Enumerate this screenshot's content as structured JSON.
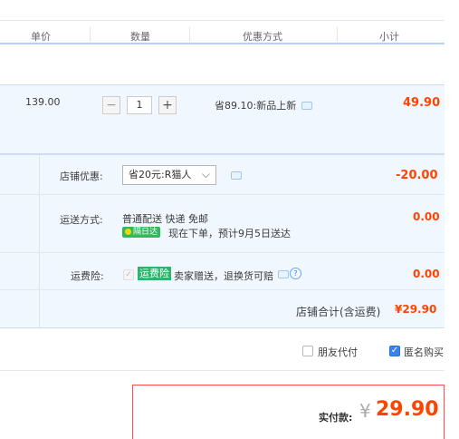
{
  "header": {
    "col_price": "单价",
    "col_qty": "数量",
    "col_promo": "优惠方式",
    "col_subtotal": "小计"
  },
  "item": {
    "unit_price": "139.00",
    "minus": "−",
    "qty": "1",
    "plus": "+",
    "promo_text": "省89.10:新品上新",
    "subtotal": "49.90"
  },
  "shop": {
    "coupon_label": "店铺优惠:",
    "coupon_select": "省20元:R猫人",
    "coupon_value": "-20.00",
    "shipping_label": "运送方式:",
    "shipping_method": "普通配送 快递 免邮",
    "sameday_badge": "隔日达",
    "shipping_eta": "现在下单，预计9月5日送达",
    "shipping_value": "0.00",
    "insurance_label": "运费险:",
    "insurance_badge": "运费险",
    "insurance_text": "卖家赠送，退换货可赔",
    "insurance_value": "0.00",
    "total_label": "店铺合计(含运费)",
    "total_value": "¥29.90"
  },
  "options": {
    "friend_pay": "朋友代付",
    "anonymous": "匿名购买"
  },
  "checkout": {
    "pay_label": "实付款:",
    "currency": "¥",
    "amount": "29.90"
  },
  "colors": {
    "accent_red": "#ff4400",
    "panel_bg": "#f1f7ff",
    "badge_green": "#2dbb5c",
    "checkbox_blue": "#3a83e8"
  }
}
